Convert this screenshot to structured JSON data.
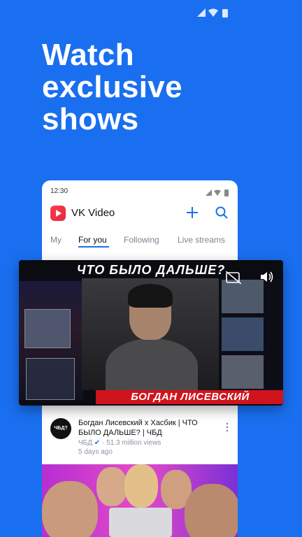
{
  "promo": {
    "headline": "Watch exclusive shows"
  },
  "phone": {
    "time": "12:30",
    "app_title": "VK Video",
    "tabs": [
      "My",
      "For you",
      "Following",
      "Live streams"
    ]
  },
  "featured_video": {
    "overlay_title": "ЧТО БЫЛО ДАЛЬШЕ?",
    "overlay_subtitle": "БОГДАН ЛИСЕВСКИЙ",
    "title": "Богдан Лисевский x Хасбик | ЧТО БЫЛО ДАЛЬШЕ? | ЧБД",
    "channel": "ЧБД",
    "channel_avatar_text": "ЧБД?",
    "views": "51.3 million views",
    "age": "5 days ago"
  },
  "colors": {
    "background": "#1a6ff0",
    "accent": "#1a6ff0",
    "brand_red": "#ff3b4f"
  },
  "icons": [
    "signal-icon",
    "wifi-icon",
    "battery-icon",
    "plus-icon",
    "search-icon",
    "captions-off-icon",
    "volume-icon",
    "verified-icon",
    "more-vertical-icon"
  ]
}
